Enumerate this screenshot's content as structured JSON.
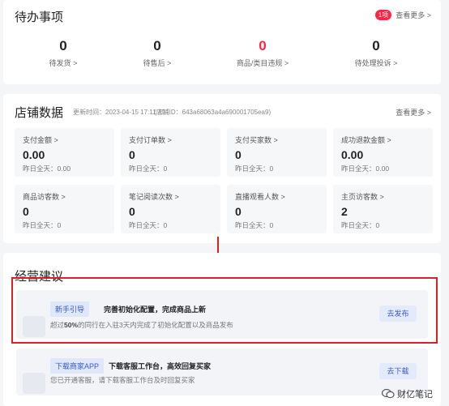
{
  "todo": {
    "title": "待办事项",
    "badge": "1项",
    "more": "查看更多 >",
    "items": [
      {
        "value": "0",
        "label": "待发货 >"
      },
      {
        "value": "0",
        "label": "待售后 >"
      },
      {
        "value": "0",
        "label": "商品/类目违规 >"
      },
      {
        "value": "0",
        "label": "待处理投诉 >"
      }
    ]
  },
  "shop": {
    "title": "店铺数据",
    "update_time": "更新时间：2023-04-15 17:11:49",
    "shop_id": "(店铺ID：643a68063a4a690001705ea9)",
    "more": "查看更多 >",
    "stats": [
      {
        "label": "支付金额 >",
        "value": "0.00",
        "sub": "昨日全天：0.00"
      },
      {
        "label": "支付订单数 >",
        "value": "0",
        "sub": "昨日全天：0"
      },
      {
        "label": "支付买家数 >",
        "value": "0",
        "sub": "昨日全天：0"
      },
      {
        "label": "成功退款金额 >",
        "value": "0.00",
        "sub": "昨日全天：0.00"
      },
      {
        "label": "商品访客数 >",
        "value": "0",
        "sub": "昨日全天：0"
      },
      {
        "label": "笔记阅读次数 >",
        "value": "0",
        "sub": "昨日全天：0"
      },
      {
        "label": "直播观看人数 >",
        "value": "0",
        "sub": "昨日全天：0"
      },
      {
        "label": "主页访客数 >",
        "value": "2",
        "sub": "昨日全天：0"
      }
    ]
  },
  "advice": {
    "title": "经营建议",
    "cards": [
      {
        "tag": "新手引导",
        "headline": "完善初始化配置，完成商品上新",
        "desc_pre": "超过",
        "desc_bold": "50%",
        "desc_post": "的同行在入驻3天内完成了初始化配置以及商品发布",
        "button": "去发布"
      },
      {
        "tag": "下载商家APP",
        "headline": "下载客服工作台，高效回复买家",
        "desc": "您已开通客服，请下载客服工作台及时回复买家",
        "button": "去下载"
      }
    ]
  },
  "watermark": "财亿笔记",
  "colors": {
    "accent": "#ff2442",
    "link": "#3a58c9",
    "highlight": "#e02020"
  }
}
